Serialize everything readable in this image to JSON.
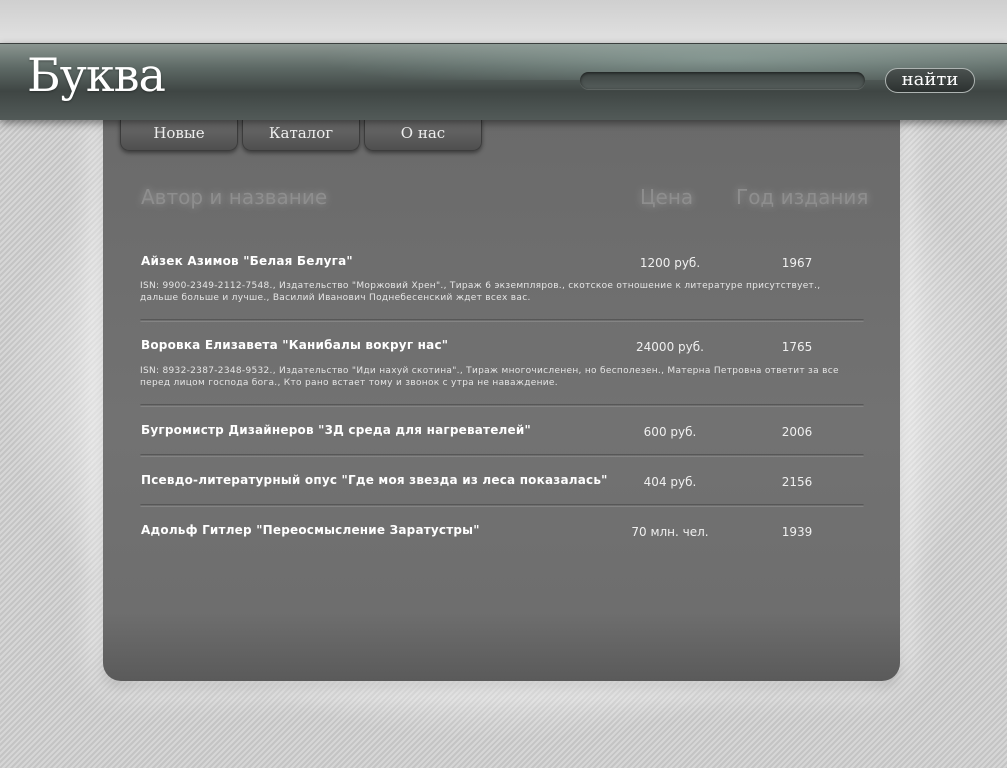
{
  "brand": {
    "logo": "Буква"
  },
  "search": {
    "value": "",
    "button_label": "найти"
  },
  "nav": {
    "tabs": [
      {
        "label": "Новые"
      },
      {
        "label": "Каталог"
      },
      {
        "label": "О нас"
      }
    ]
  },
  "table": {
    "headers": {
      "title": "Автор и название",
      "price": "Цена",
      "year": "Год издания"
    },
    "rows": [
      {
        "title": "Айзек Азимов \"Белая Белуга\"",
        "price": "1200 руб.",
        "year": "1967",
        "description": "ISN: 9900-2349-2112-7548., Издательство \"Моржовий Хрен\"., Тираж 6 экземпляров., скотское отношение к литературе присутствует., дальше больше и лучше., Василий Иванович Поднебесенский ждет всех вас."
      },
      {
        "title": "Воровка Елизавета \"Канибалы вокруг нас\"",
        "price": "24000 руб.",
        "year": "1765",
        "description": "ISN: 8932-2387-2348-9532., Издательство \"Иди нахуй скотина\"., Тираж многочисленен, но бесполезен., Матерна Петровна ответит за все перед лицом господа бога., Кто рано встает тому и звонок с утра не наваждение."
      },
      {
        "title": "Бугромистр Дизайнеров \"3Д среда для нагревателей\"",
        "price": "600 руб.",
        "year": "2006"
      },
      {
        "title": "Псевдо-литературный опус \"Где моя звезда из леса показалась\"",
        "price": "404 руб.",
        "year": "2156"
      },
      {
        "title": "Адольф Гитлер \"Переосмысление Заратустры\"",
        "price": "70 млн. чел.",
        "year": "1939"
      }
    ]
  }
}
